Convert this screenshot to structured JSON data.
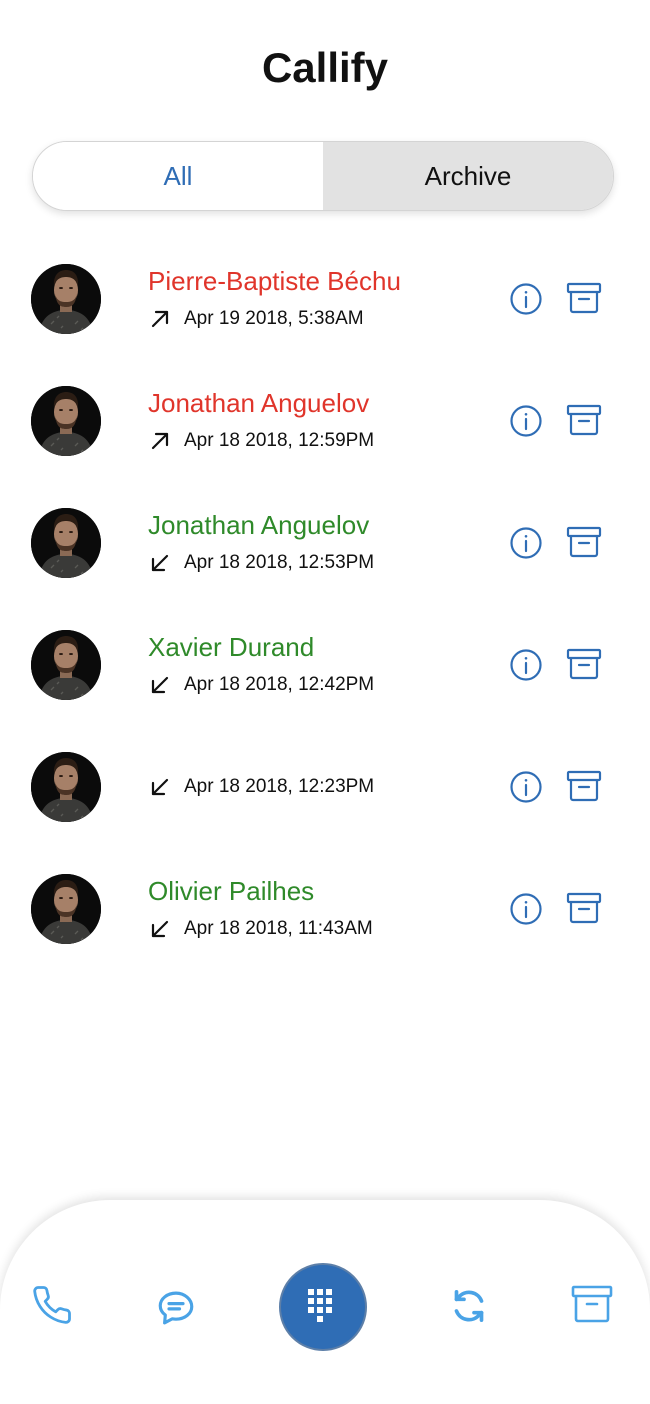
{
  "app": {
    "title": "Callify"
  },
  "tabs": [
    {
      "label": "All",
      "selected": true
    },
    {
      "label": "Archive",
      "selected": false
    }
  ],
  "colors": {
    "accent": "#2f6db5",
    "nav_icon": "#4aa3e6",
    "missed": "#e0352b",
    "answered": "#2f8a2a",
    "segment_inactive_bg": "#e2e2e2"
  },
  "calls": [
    {
      "name": "Pierre-Baptiste Béchu",
      "status": "missed",
      "direction": "outgoing",
      "direction_icon": "arrow-up-right-icon",
      "datetime": "Apr 19 2018, 5:38AM"
    },
    {
      "name": "Jonathan Anguelov",
      "status": "missed",
      "direction": "outgoing",
      "direction_icon": "arrow-up-right-icon",
      "datetime": "Apr 18 2018, 12:59PM"
    },
    {
      "name": "Jonathan Anguelov",
      "status": "answered",
      "direction": "incoming",
      "direction_icon": "arrow-down-left-icon",
      "datetime": "Apr 18 2018, 12:53PM"
    },
    {
      "name": "Xavier Durand",
      "status": "answered",
      "direction": "incoming",
      "direction_icon": "arrow-down-left-icon",
      "datetime": "Apr 18 2018, 12:42PM"
    },
    {
      "name": "",
      "status": "answered",
      "direction": "incoming",
      "direction_icon": "arrow-down-left-icon",
      "datetime": "Apr 18 2018, 12:23PM"
    },
    {
      "name": "Olivier Pailhes",
      "status": "answered",
      "direction": "incoming",
      "direction_icon": "arrow-down-left-icon",
      "datetime": "Apr 18 2018, 11:43AM"
    }
  ],
  "row_actions": {
    "info_icon": "info-icon",
    "archive_icon": "archive-box-icon"
  },
  "bottom_nav": [
    {
      "id": "calls",
      "icon": "phone-icon"
    },
    {
      "id": "messages",
      "icon": "chat-bubble-icon"
    },
    {
      "id": "dialpad",
      "icon": "dialpad-icon"
    },
    {
      "id": "sync",
      "icon": "sync-icon"
    },
    {
      "id": "archive",
      "icon": "archive-box-icon"
    }
  ]
}
